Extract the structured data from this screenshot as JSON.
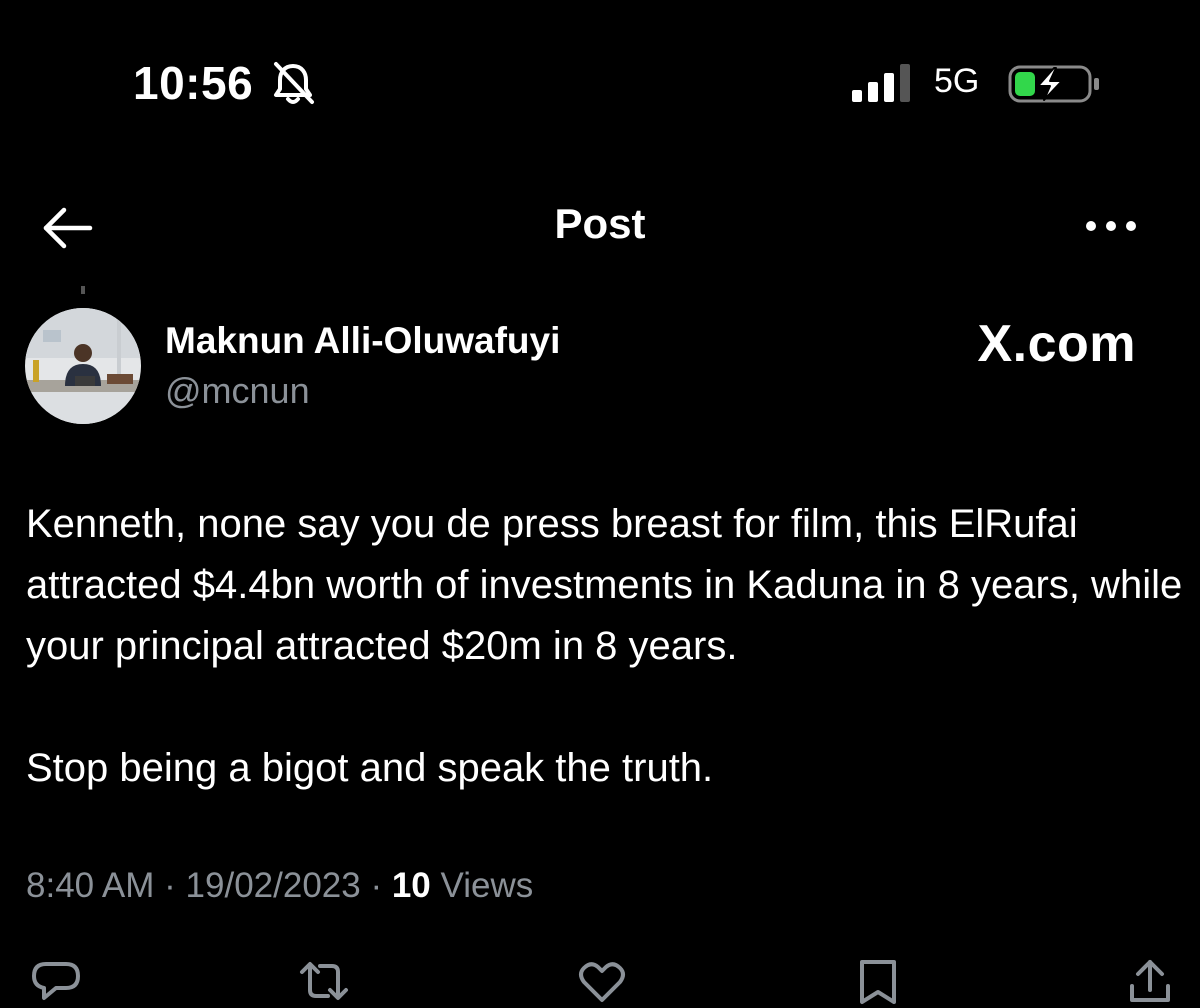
{
  "status_bar": {
    "time": "10:56",
    "network": "5G",
    "icons": [
      "bell-slash-icon",
      "cellular-signal-icon",
      "battery-charging-icon"
    ],
    "battery_color": "#32d74b"
  },
  "nav": {
    "title": "Post",
    "back_icon": "arrow-left-icon",
    "more_icon": "more-horizontal-icon"
  },
  "author": {
    "name": "Maknun Alli-Oluwafuyi",
    "handle": "@mcnun"
  },
  "watermark": "X.com",
  "post": {
    "paragraphs": [
      "Kenneth, none say you de press breast for film, this ElRufai attracted $4.4bn worth of investments in Kaduna in 8 years, while your principal attracted $20m in 8 years.",
      "Stop being a bigot and speak the truth."
    ],
    "time": "8:40 AM",
    "separator": "·",
    "date": "19/02/2023",
    "views_count": "10",
    "views_label": "Views"
  },
  "actions": [
    "reply-icon",
    "repost-icon",
    "like-icon",
    "bookmark-icon",
    "share-icon"
  ],
  "colors": {
    "background": "#000000",
    "text": "#ffffff",
    "secondary_text": "#8b9198"
  }
}
